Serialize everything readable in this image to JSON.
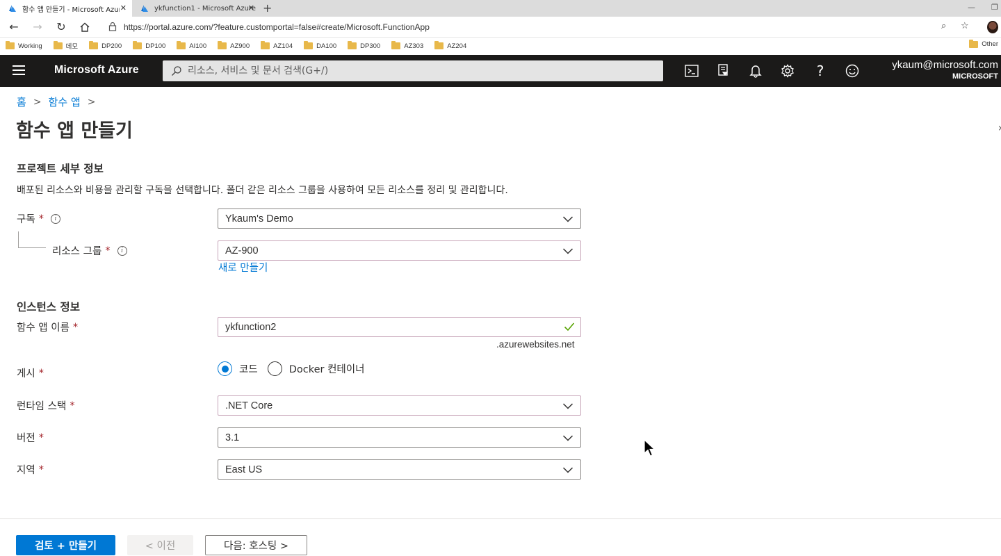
{
  "browser": {
    "tabs": [
      {
        "title": "함수 앱 만들기 - Microsoft Azure",
        "active": true
      },
      {
        "title": "ykfunction1 - Microsoft Azure",
        "active": false
      }
    ],
    "url": "https://portal.azure.com/?feature.customportal=false#create/Microsoft.FunctionApp",
    "bookmarks": [
      "Working",
      "데모",
      "DP200",
      "DP100",
      "AI100",
      "AZ900",
      "AZ104",
      "DA100",
      "DP300",
      "AZ303",
      "AZ204"
    ],
    "bookmarks_other": "Other"
  },
  "azure_header": {
    "brand": "Microsoft Azure",
    "search_placeholder": "리소스, 서비스 및 문서 검색(G+/)",
    "account_email": "ykaum@microsoft.com",
    "account_tenant": "MICROSOFT",
    "icons": [
      "cloud-shell-icon",
      "directory-filter-icon",
      "notifications-icon",
      "settings-icon",
      "help-icon",
      "feedback-icon"
    ]
  },
  "breadcrumb": {
    "items": [
      "홈",
      "함수 앱"
    ]
  },
  "page": {
    "title": "함수 앱 만들기"
  },
  "project": {
    "heading": "프로젝트 세부 정보",
    "description": "배포된 리소스와 비용을 관리할 구독을 선택합니다. 폴더 같은 리소스 그룹을 사용하여 모든 리소스를 정리 및 관리합니다.",
    "subscription_label": "구독",
    "subscription_value": "Ykaum's Demo",
    "resource_group_label": "리소스 그룹",
    "resource_group_value": "AZ-900",
    "create_new_link": "새로 만들기"
  },
  "instance": {
    "heading": "인스턴스 정보",
    "name_label": "함수 앱 이름",
    "name_value": "ykfunction2",
    "name_suffix": ".azurewebsites.net",
    "publish_label": "게시",
    "publish_options": [
      "코드",
      "Docker 컨테이너"
    ],
    "publish_selected": "코드",
    "runtime_label": "런타임 스택",
    "runtime_value": ".NET Core",
    "version_label": "버전",
    "version_value": "3.1",
    "region_label": "지역",
    "region_value": "East US"
  },
  "footer": {
    "review_create": "검토 + 만들기",
    "previous": "< 이전",
    "next": "다음: 호스팅 >"
  },
  "required_marker": "*",
  "colors": {
    "accent": "#0078d4",
    "header_bg": "#1b1a19",
    "required": "#a4262c",
    "valid": "#57a300"
  }
}
